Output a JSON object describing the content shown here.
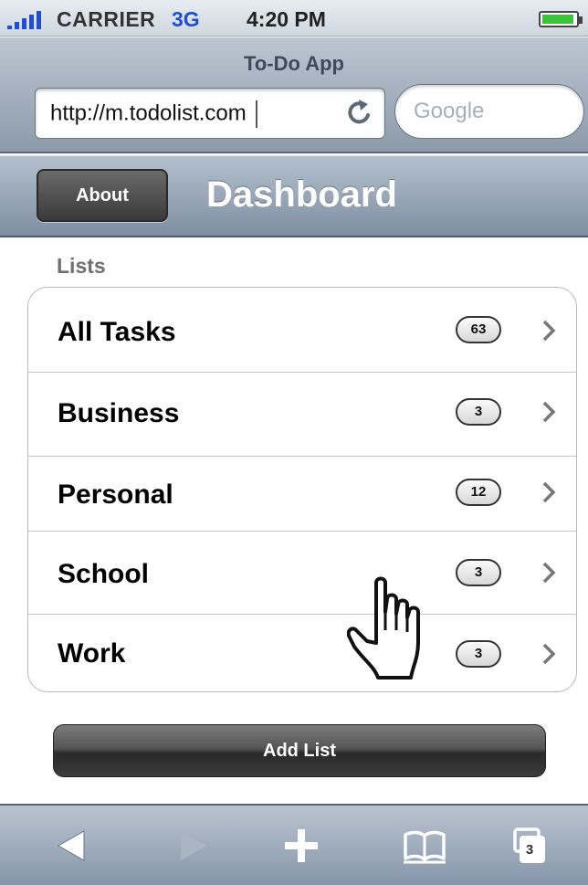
{
  "status_bar": {
    "carrier": "CARRIER",
    "network": "3G",
    "time": "4:20 PM"
  },
  "browser": {
    "page_title": "To-Do App",
    "url": "http://m.todolist.com",
    "search_placeholder": "Google"
  },
  "nav_bar": {
    "about_label": "About",
    "title": "Dashboard"
  },
  "lists": {
    "section_label": "Lists",
    "items": [
      {
        "label": "All Tasks",
        "count": "63"
      },
      {
        "label": "Business",
        "count": "3"
      },
      {
        "label": "Personal",
        "count": "12"
      },
      {
        "label": "School",
        "count": "3"
      },
      {
        "label": "Work",
        "count": "3"
      }
    ]
  },
  "add_list": {
    "label": "Add List"
  },
  "toolbar": {
    "tab_count": "3",
    "icons": [
      "back-icon",
      "forward-icon",
      "add-icon",
      "bookmarks-icon",
      "tabs-icon"
    ]
  },
  "colors": {
    "signal_blue": "#1f4fd0",
    "battery_green": "#3ec23e",
    "nav_bar_top": "#b4c0cd",
    "nav_bar_bottom": "#7e8ea2"
  }
}
